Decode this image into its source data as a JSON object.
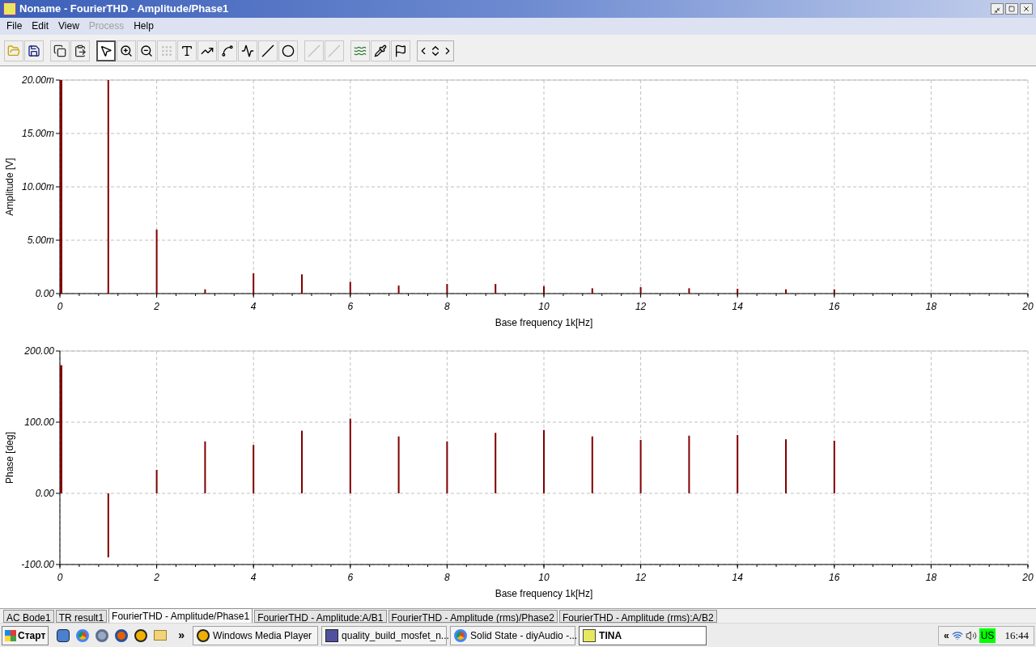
{
  "window": {
    "title": "Noname - FourierTHD - Amplitude/Phase1"
  },
  "menu": [
    {
      "label": "File",
      "disabled": false
    },
    {
      "label": "Edit",
      "disabled": false
    },
    {
      "label": "View",
      "disabled": false
    },
    {
      "label": "Process",
      "disabled": true
    },
    {
      "label": "Help",
      "disabled": false
    }
  ],
  "toolbar": {
    "groups": [
      {
        "tools": [
          {
            "kind": "open",
            "selected": false,
            "disabled": false
          },
          {
            "kind": "save",
            "selected": false,
            "disabled": false
          }
        ]
      },
      {
        "tools": [
          {
            "kind": "copy",
            "selected": false,
            "disabled": false
          },
          {
            "kind": "paste",
            "selected": false,
            "disabled": false
          }
        ]
      },
      {
        "tools": [
          {
            "kind": "pointer",
            "selected": true,
            "disabled": false
          },
          {
            "kind": "zoom-in",
            "selected": false,
            "disabled": false
          },
          {
            "kind": "zoom-out",
            "selected": false,
            "disabled": false
          },
          {
            "kind": "grid",
            "selected": false,
            "disabled": true
          },
          {
            "kind": "text",
            "selected": false,
            "disabled": false
          },
          {
            "kind": "curve-label",
            "selected": false,
            "disabled": false
          },
          {
            "kind": "curve-query",
            "selected": false,
            "disabled": false
          },
          {
            "kind": "curve-legend",
            "selected": false,
            "disabled": false
          },
          {
            "kind": "line",
            "selected": false,
            "disabled": false
          },
          {
            "kind": "circle",
            "selected": false,
            "disabled": false
          }
        ]
      },
      {
        "tools": [
          {
            "kind": "line",
            "selected": false,
            "disabled": true
          },
          {
            "kind": "line",
            "selected": false,
            "disabled": true
          }
        ]
      },
      {
        "tools": [
          {
            "kind": "add-curve",
            "selected": false,
            "disabled": false
          },
          {
            "kind": "add-marker",
            "selected": false,
            "disabled": false
          },
          {
            "kind": "flag",
            "selected": false,
            "disabled": false
          }
        ]
      },
      {
        "tools": [
          {
            "kind": "nav"
          }
        ]
      }
    ]
  },
  "charts": [
    {
      "chart_data": {
        "type": "bar",
        "grid": true,
        "xlabel": "Base frequency 1k[Hz]",
        "ylabel": "Amplitude [V]",
        "x": [
          0,
          1,
          2,
          3,
          4,
          5,
          6,
          7,
          8,
          9,
          10,
          11,
          12,
          13,
          14,
          15,
          16
        ],
        "series": [
          {
            "color": "#800000",
            "values": [
              20,
              20,
              6,
              0.4,
              1.9,
              1.8,
              1.1,
              0.75,
              0.9,
              0.9,
              0.7,
              0.5,
              0.6,
              0.5,
              0.45,
              0.4,
              0.4
            ]
          }
        ],
        "xlim": [
          0,
          20
        ],
        "ylim": [
          0,
          20
        ],
        "xticks": [
          0,
          2,
          4,
          6,
          8,
          10,
          12,
          14,
          16,
          18,
          20
        ],
        "yticks": [
          {
            "value": 0,
            "label": "0.00"
          },
          {
            "value": 5,
            "label": "5.00m"
          },
          {
            "value": 10,
            "label": "10.00m"
          },
          {
            "value": 15,
            "label": "15.00m"
          },
          {
            "value": 20,
            "label": "20.00m"
          }
        ]
      }
    },
    {
      "chart_data": {
        "type": "bar",
        "grid": true,
        "xlabel": "Base frequency 1k[Hz]",
        "ylabel": "Phase [deg]",
        "x": [
          0,
          1,
          2,
          3,
          4,
          5,
          6,
          7,
          8,
          9,
          10,
          11,
          12,
          13,
          14,
          15,
          16
        ],
        "series": [
          {
            "color": "#800000",
            "values": [
              180,
              -90,
              33,
              73,
              68,
              88,
              105,
              80,
              73,
              85,
              89,
              80,
              75,
              81,
              82,
              76,
              74
            ]
          }
        ],
        "xlim": [
          0,
          20
        ],
        "ylim": [
          -100,
          200
        ],
        "xticks": [
          0,
          2,
          4,
          6,
          8,
          10,
          12,
          14,
          16,
          18,
          20
        ],
        "yticks": [
          {
            "value": -100,
            "label": "-100.00"
          },
          {
            "value": 0,
            "label": "0.00"
          },
          {
            "value": 100,
            "label": "100.00"
          },
          {
            "value": 200,
            "label": "200.00"
          }
        ]
      }
    }
  ],
  "tabs": [
    {
      "label": "AC Bode1",
      "selected": false
    },
    {
      "label": "TR result1",
      "selected": false
    },
    {
      "label": "FourierTHD - Amplitude/Phase1",
      "selected": true
    },
    {
      "label": "FourierTHD - Amplitude:A/B1",
      "selected": false
    },
    {
      "label": "FourierTHD - Amplitude (rms)/Phase2",
      "selected": false
    },
    {
      "label": "FourierTHD - Amplitude (rms):A/B2",
      "selected": false
    }
  ],
  "taskbar": {
    "start": "Старт",
    "more": "»",
    "tasks": [
      {
        "label": "Windows Media Player",
        "kind": "media",
        "selected": false
      },
      {
        "label": "quality_build_mosfet_n...",
        "kind": "doc",
        "selected": false
      },
      {
        "label": "Solid State - diyAudio -...",
        "kind": "browser",
        "selected": false
      },
      {
        "label": "TINA",
        "kind": "app",
        "selected": true
      }
    ],
    "tray": {
      "expand": "«",
      "language": "US",
      "time": "16:44"
    }
  }
}
